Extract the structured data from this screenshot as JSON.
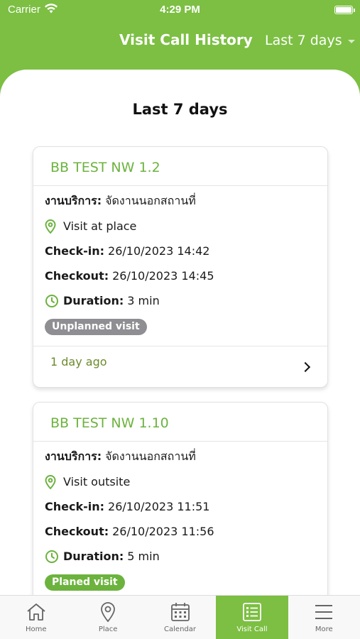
{
  "status_bar": {
    "carrier": "Carrier",
    "time": "4:29 PM"
  },
  "header": {
    "title": "Visit Call History",
    "period": "Last 7 days"
  },
  "section_title": "Last 7 days",
  "cards": [
    {
      "title": "BB TEST NW 1.2",
      "service_label": "งานบริการ:",
      "service_value": "จัดงานนอกสถานที่",
      "visit_type": "Visit at place",
      "checkin_label": "Check-in:",
      "checkin_value": "26/10/2023 14:42",
      "checkout_label": "Checkout:",
      "checkout_value": "26/10/2023 14:45",
      "duration_label": "Duration:",
      "duration_value": "3 min",
      "badge": "Unplanned visit",
      "badge_color": "#8e8e93",
      "ago": "1 day ago"
    },
    {
      "title": "BB TEST NW 1.10",
      "service_label": "งานบริการ:",
      "service_value": "จัดงานนอกสถานที่",
      "visit_type": "Visit outsite",
      "checkin_label": "Check-in:",
      "checkin_value": "26/10/2023 11:51",
      "checkout_label": "Checkout:",
      "checkout_value": "26/10/2023 11:56",
      "duration_label": "Duration:",
      "duration_value": "5 min",
      "badge": "Planed visit",
      "badge_color": "#6cb33e"
    }
  ],
  "tabs": [
    {
      "label": "Home",
      "icon": "home-icon"
    },
    {
      "label": "Place",
      "icon": "location-pin-icon"
    },
    {
      "label": "Calendar",
      "icon": "calendar-icon"
    },
    {
      "label": "Visit Call",
      "icon": "list-icon",
      "active": true
    },
    {
      "label": "More",
      "icon": "menu-icon"
    }
  ],
  "colors": {
    "brand_green": "#7cbf43",
    "title_green": "#6cb33e",
    "badge_gray": "#8e8e93"
  }
}
